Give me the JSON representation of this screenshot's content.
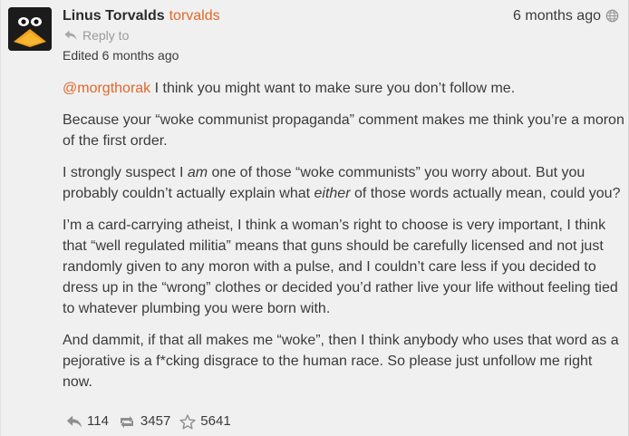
{
  "author": {
    "display_name": "Linus Torvalds",
    "username": "torvalds",
    "avatar": "penguin-avatar"
  },
  "meta": {
    "timestamp": "6 months ago",
    "visibility_icon": "globe-icon",
    "reply_to": "Reply to",
    "edited": "Edited 6 months ago"
  },
  "post": {
    "p1_mention": "@morgthorak",
    "p1_text": " I think you might want to make sure you don’t follow me.",
    "p2": "Because your “woke communist propaganda” comment makes me think you’re a moron of the first order.",
    "p3_a": "I strongly suspect I ",
    "p3_em1": "am",
    "p3_b": " one of those “woke communists” you worry about. But you probably couldn’t actually explain what ",
    "p3_em2": "either",
    "p3_c": " of those words actually mean, could you?",
    "p4": "I’m a card-carrying atheist, I think a woman’s right to choose is very important, I think that “well regulated militia” means that guns should be carefully licensed and not just randomly given to any moron with a pulse, and I couldn’t care less if you decided to dress up in the “wrong” clothes or decided you’d rather live your life without feeling tied to whatever plumbing you were born with.",
    "p5": "And dammit, if that all makes me “woke”, then I think anybody who uses that word as a pejorative is a f*cking disgrace to the human race. So please just unfollow me right now."
  },
  "actions": {
    "replies": "114",
    "boosts": "3457",
    "favourites": "5641"
  },
  "colors": {
    "accent": "#e2662a",
    "background": "#f0f0f0",
    "text": "#3b3b3b",
    "muted": "#9a9a9a"
  }
}
